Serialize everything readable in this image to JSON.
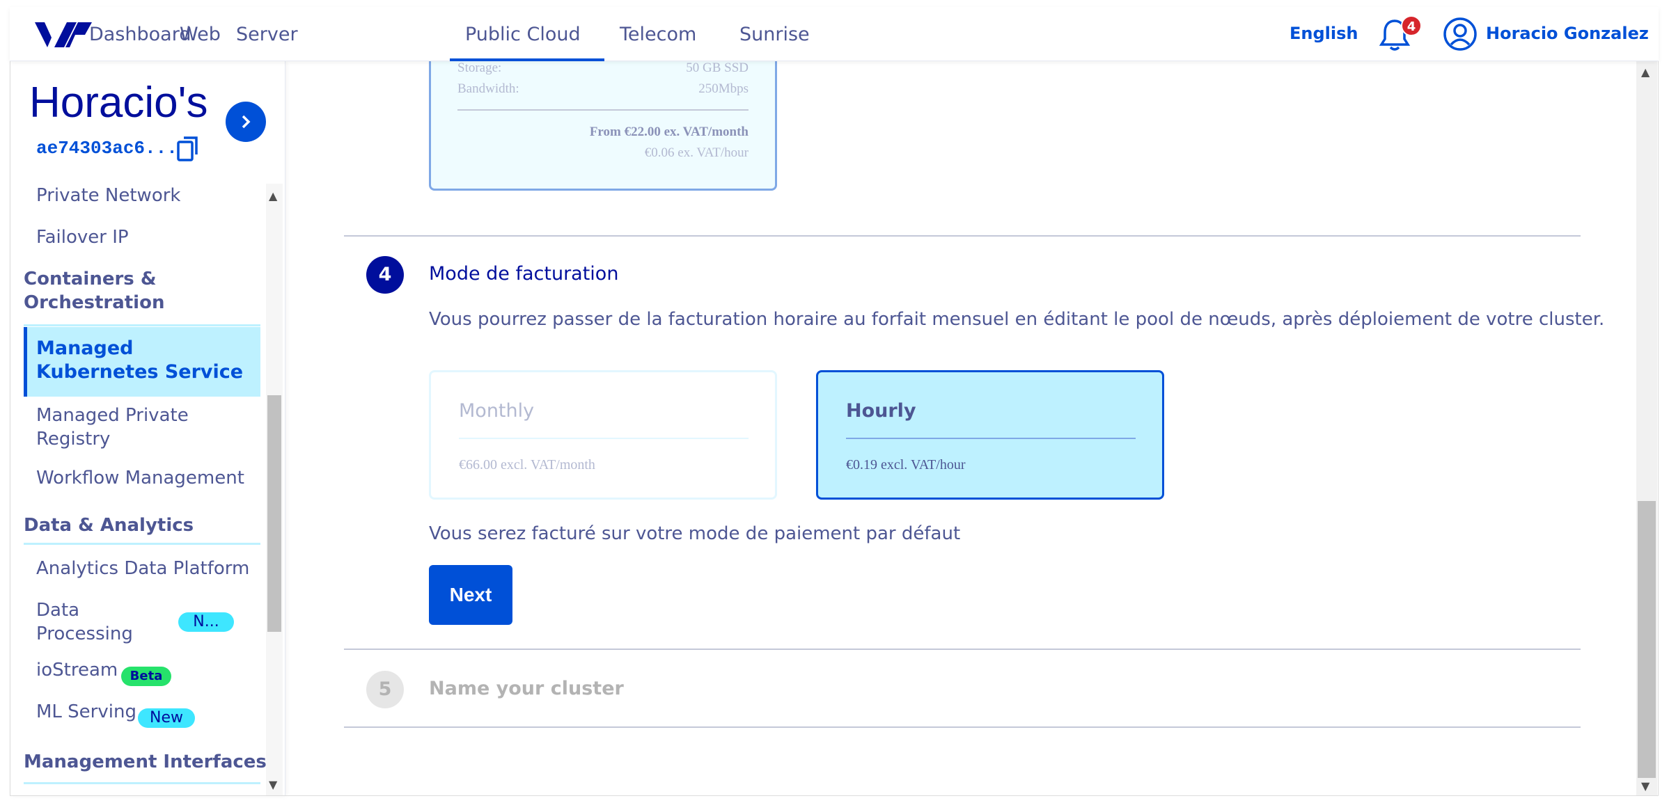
{
  "topbar": {
    "nav": [
      "Dashboard",
      "Web",
      "Server",
      "Public Cloud",
      "Telecom",
      "Sunrise"
    ],
    "active_nav": "Public Cloud",
    "language": "English",
    "notification_count": "4",
    "user_name": "Horacio Gonzalez"
  },
  "sidebar": {
    "project_title": "Horacio's",
    "project_id": "ae74303ac6...",
    "items_top": [
      "Private Network",
      "Failover IP"
    ],
    "group_containers": "Containers & Orchestration",
    "active_item": "Managed Kubernetes Service",
    "items_containers": [
      "Managed Private Registry",
      "Workflow Management"
    ],
    "group_data": "Data & Analytics",
    "items_data": [
      "Analytics Data Platform",
      "Data Processing",
      "ioStream",
      "ML Serving"
    ],
    "badge_data_processing": "N...",
    "badge_iostream": "Beta",
    "badge_ml_serving": "New",
    "group_management": "Management Interfaces"
  },
  "prev_card": {
    "storage_label": "Storage:",
    "storage_value": "50 GB SSD",
    "bandwidth_label": "Bandwidth:",
    "bandwidth_value": "250Mbps",
    "price_month": "From €22.00 ex. VAT/month",
    "price_hour": "€0.06 ex. VAT/hour"
  },
  "step4": {
    "number": "4",
    "title": "Mode de facturation",
    "description": "Vous pourrez passer de la facturation horaire au forfait mensuel en éditant le pool de nœuds, après déploiement de votre cluster.",
    "options": [
      {
        "name": "Monthly",
        "price": "€66.00 excl. VAT/month",
        "selected": false
      },
      {
        "name": "Hourly",
        "price": "€0.19 excl. VAT/hour",
        "selected": true
      }
    ],
    "billing_note": "Vous serez facturé sur votre mode de paiement par défaut",
    "next_label": "Next"
  },
  "step5": {
    "number": "5",
    "title": "Name your cluster"
  },
  "colors": {
    "brand_blue": "#0050d7",
    "dark_blue": "#000e9c",
    "selected_bg": "#bef1ff",
    "text": "#4d5693"
  }
}
